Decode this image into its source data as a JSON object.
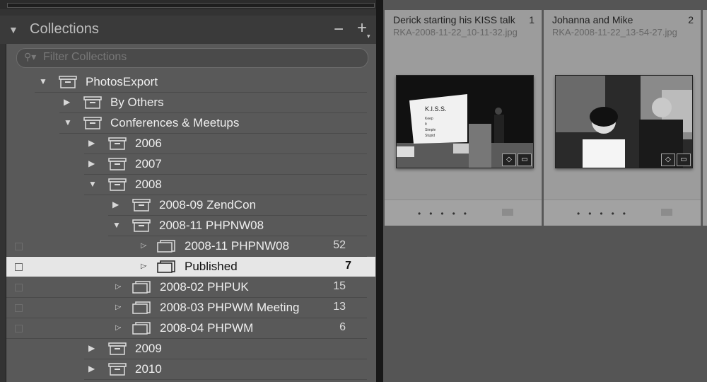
{
  "collections_panel": {
    "title": "Collections",
    "minus_label": "−",
    "plus_label": "+",
    "search_placeholder": "Filter Collections",
    "tree": [
      {
        "label": "PhotosExport",
        "expanded": true
      },
      {
        "label": "By Others",
        "expanded": false
      },
      {
        "label": "Conferences & Meetups",
        "expanded": true
      },
      {
        "label": "2006",
        "expanded": false
      },
      {
        "label": "2007",
        "expanded": false
      },
      {
        "label": "2008",
        "expanded": true
      },
      {
        "label": "2008-09 ZendCon",
        "expanded": false
      },
      {
        "label": "2008-11 PHPNW08",
        "expanded": true
      },
      {
        "label": "2008-11 PHPNW08",
        "count": "52"
      },
      {
        "label": "Published",
        "count": "7",
        "selected": true
      },
      {
        "label": "2008-02 PHPUK",
        "count": "15"
      },
      {
        "label": "2008-03 PHPWM Meeting",
        "count": "13"
      },
      {
        "label": "2008-04 PHPWM",
        "count": "6"
      },
      {
        "label": "2009",
        "expanded": false
      },
      {
        "label": "2010",
        "expanded": false
      }
    ]
  },
  "grid": {
    "cells": [
      {
        "title": "Derick starting his KISS talk",
        "filename": "RKA-2008-11-22_10-11-32.jpg",
        "index": "1",
        "slide_lines": [
          "K.I.S.S.",
          "Keep",
          "It",
          "Simple",
          "Stupid"
        ]
      },
      {
        "title": "Johanna and Mike",
        "filename": "RKA-2008-11-22_13-54-27.jpg",
        "index": "2"
      }
    ]
  },
  "colors": {
    "selected_row": "#e6e6e6",
    "panel_bg": "#595959",
    "grid_cell": "#9c9c9c"
  }
}
